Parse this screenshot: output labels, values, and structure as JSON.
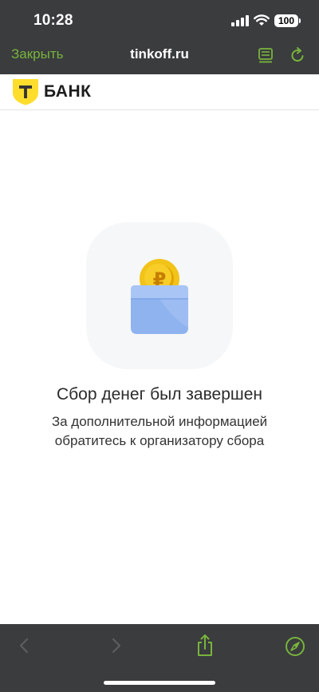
{
  "status_bar": {
    "time": "10:28",
    "battery": "100"
  },
  "browser": {
    "close_label": "Закрыть",
    "url": "tinkoff.ru"
  },
  "bank_header": {
    "logo_letter": "Т",
    "name": "БАНК"
  },
  "main": {
    "coin_symbol": "₽",
    "title": "Сбор денег был завершен",
    "subtitle_line1": "За дополнительной информацией",
    "subtitle_line2": "обратитесь к организатору сбора"
  },
  "colors": {
    "chrome_bg": "#3a3c3e",
    "accent_green": "#78b43c",
    "brand_yellow": "#ffdd2d",
    "jar_blue": "#8fb3ef",
    "coin_gold": "#f2c318"
  },
  "icons": {
    "reader": "reader-icon",
    "reload": "reload-icon",
    "back": "chevron-left-icon",
    "forward": "chevron-right-icon",
    "share": "share-icon",
    "compass": "compass-icon"
  }
}
